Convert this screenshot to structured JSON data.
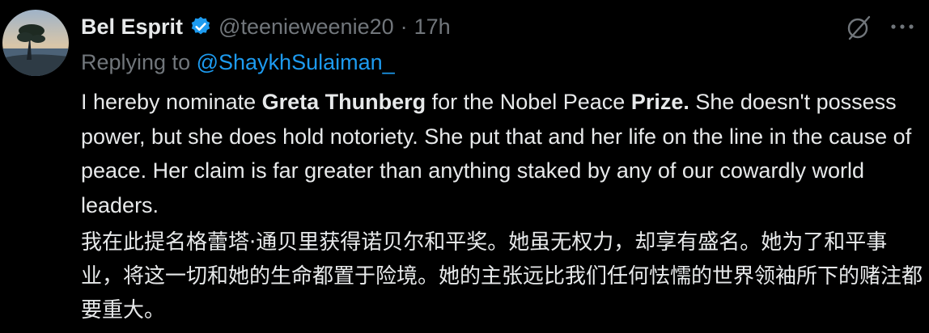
{
  "author": {
    "name": "Bel Esprit",
    "handle": "@teenieweenie20",
    "separator": "·",
    "time": "17h",
    "verified": true,
    "avatar_icon": "avatar-landscape-tree-image"
  },
  "reply": {
    "prefix": "Replying to",
    "mention": "@ShaykhSulaiman_"
  },
  "body": {
    "en": [
      {
        "text": "I hereby nominate ",
        "bold": false
      },
      {
        "text": "Greta Thunberg",
        "bold": true
      },
      {
        "text": " for the Nobel Peace ",
        "bold": false
      },
      {
        "text": "Prize.",
        "bold": true
      },
      {
        "text": " She doesn't possess power, but she does hold notoriety. She put that and her life on the line in the cause of peace. Her claim is far greater than anything staked by any of our cowardly world leaders.",
        "bold": false
      }
    ],
    "zh": "我在此提名格蕾塔·通贝里获得诺贝尔和平奖。她虽无权力，却享有盛名。她为了和平事业，将这一切和她的生命都置于险境。她的主张远比我们任何怯懦的世界领袖所下的赌注都要重大。"
  },
  "icons": {
    "verified": "verified-badge-icon",
    "grok": "grok-icon",
    "more": "more-options-icon"
  },
  "colors": {
    "background": "#000000",
    "text": "#e7e9ea",
    "secondary": "#71767b",
    "accent": "#1d9bf0"
  }
}
